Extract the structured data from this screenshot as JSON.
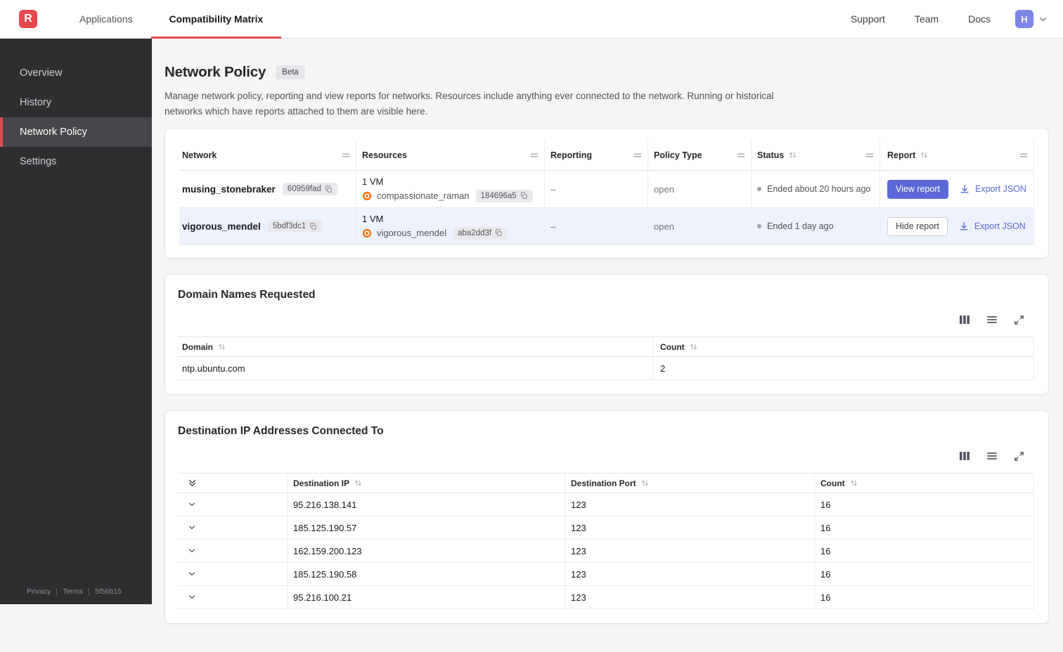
{
  "topbar": {
    "nav": [
      {
        "label": "Applications"
      },
      {
        "label": "Compatibility Matrix"
      }
    ],
    "links": [
      {
        "label": "Support"
      },
      {
        "label": "Team"
      },
      {
        "label": "Docs"
      }
    ],
    "logo_letter": "R",
    "avatar_initial": "H"
  },
  "sidebar": {
    "items": [
      {
        "label": "Overview"
      },
      {
        "label": "History"
      },
      {
        "label": "Network Policy"
      },
      {
        "label": "Settings"
      }
    ],
    "footer": {
      "privacy": "Privacy",
      "terms": "Terms",
      "build": "5f56b15"
    }
  },
  "page": {
    "title": "Network Policy",
    "badge": "Beta",
    "description": "Manage network policy, reporting and view reports for networks. Resources include anything ever connected to the network. Running or historical networks which have reports attached to them are visible here."
  },
  "networks": {
    "columns": {
      "network": "Network",
      "resources": "Resources",
      "reporting": "Reporting",
      "policy_type": "Policy Type",
      "status": "Status",
      "report": "Report"
    },
    "rows": [
      {
        "name": "musing_stonebraker",
        "id": "60959fad",
        "vm_count": "1 VM",
        "resource_name": "compassionate_raman",
        "resource_id": "184696a5",
        "reporting": "–",
        "policy_type": "open",
        "status": "Ended about 20 hours ago",
        "report_action": "View report",
        "export_label": "Export JSON"
      },
      {
        "name": "vigorous_mendel",
        "id": "5bdf3dc1",
        "vm_count": "1 VM",
        "resource_name": "vigorous_mendel",
        "resource_id": "aba2dd3f",
        "reporting": "–",
        "policy_type": "open",
        "status": "Ended 1 day ago",
        "report_action": "Hide report",
        "export_label": "Export JSON"
      }
    ]
  },
  "domains": {
    "title": "Domain Names Requested",
    "columns": {
      "domain": "Domain",
      "count": "Count"
    },
    "rows": [
      {
        "domain": "ntp.ubuntu.com",
        "count": "2"
      }
    ]
  },
  "destinations": {
    "title": "Destination IP Addresses Connected To",
    "columns": {
      "ip": "Destination IP",
      "port": "Destination Port",
      "count": "Count"
    },
    "rows": [
      {
        "ip": "95.216.138.141",
        "port": "123",
        "count": "16"
      },
      {
        "ip": "185.125.190.57",
        "port": "123",
        "count": "16"
      },
      {
        "ip": "162.159.200.123",
        "port": "123",
        "count": "16"
      },
      {
        "ip": "185.125.190.58",
        "port": "123",
        "count": "16"
      },
      {
        "ip": "95.216.100.21",
        "port": "123",
        "count": "16"
      }
    ]
  },
  "colors": {
    "accent_red": "#e5484d",
    "accent_indigo": "#5b68d8",
    "selected_row": "#edf2fc",
    "resource_icon_orange": "#f97316"
  }
}
